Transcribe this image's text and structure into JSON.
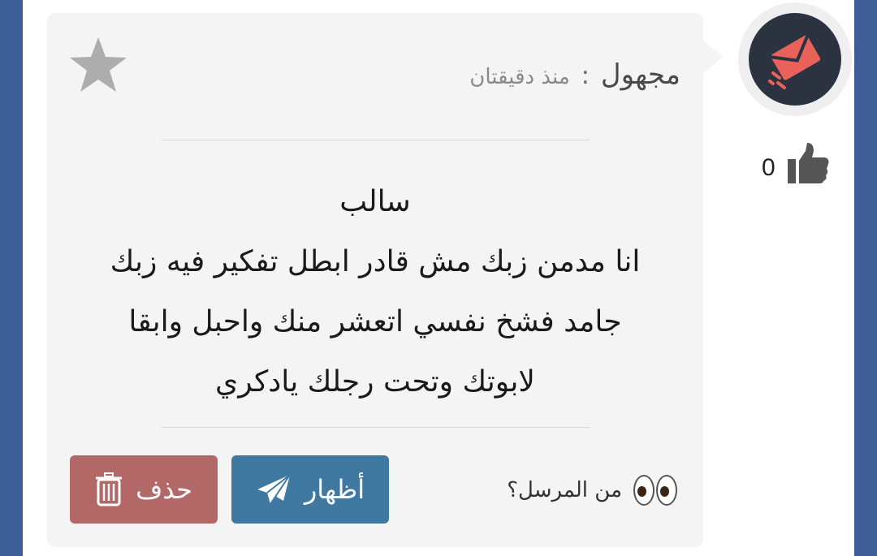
{
  "message_card": {
    "author": "مجهول",
    "separator": ":",
    "time_ago": "منذ دقيقتان",
    "body_lines": [
      "سالب",
      "انا مدمن زبك مش قادر ابطل تفكير فيه زبك",
      "جامد فشخ نفسي اتعشر منك واحبل وابقا",
      "لابوتك وتحت رجلك يادكري"
    ],
    "sender_prompt": "من المرسل؟",
    "show_label": "أظهار",
    "delete_label": "حذف"
  },
  "likes": {
    "count": "0"
  },
  "icons": {
    "avatar": "envelope-send-icon",
    "like": "thumbs-up-icon",
    "favorite": "star-icon",
    "sender": "eyes-icon",
    "show": "paper-plane-icon",
    "delete": "trash-icon"
  },
  "colors": {
    "frame": "#3d5d96",
    "card": "#f4f4f4",
    "show_button": "#3f78a1",
    "delete_button": "#b36868",
    "avatar_bg": "#2b3240",
    "avatar_accent": "#e8625a"
  }
}
